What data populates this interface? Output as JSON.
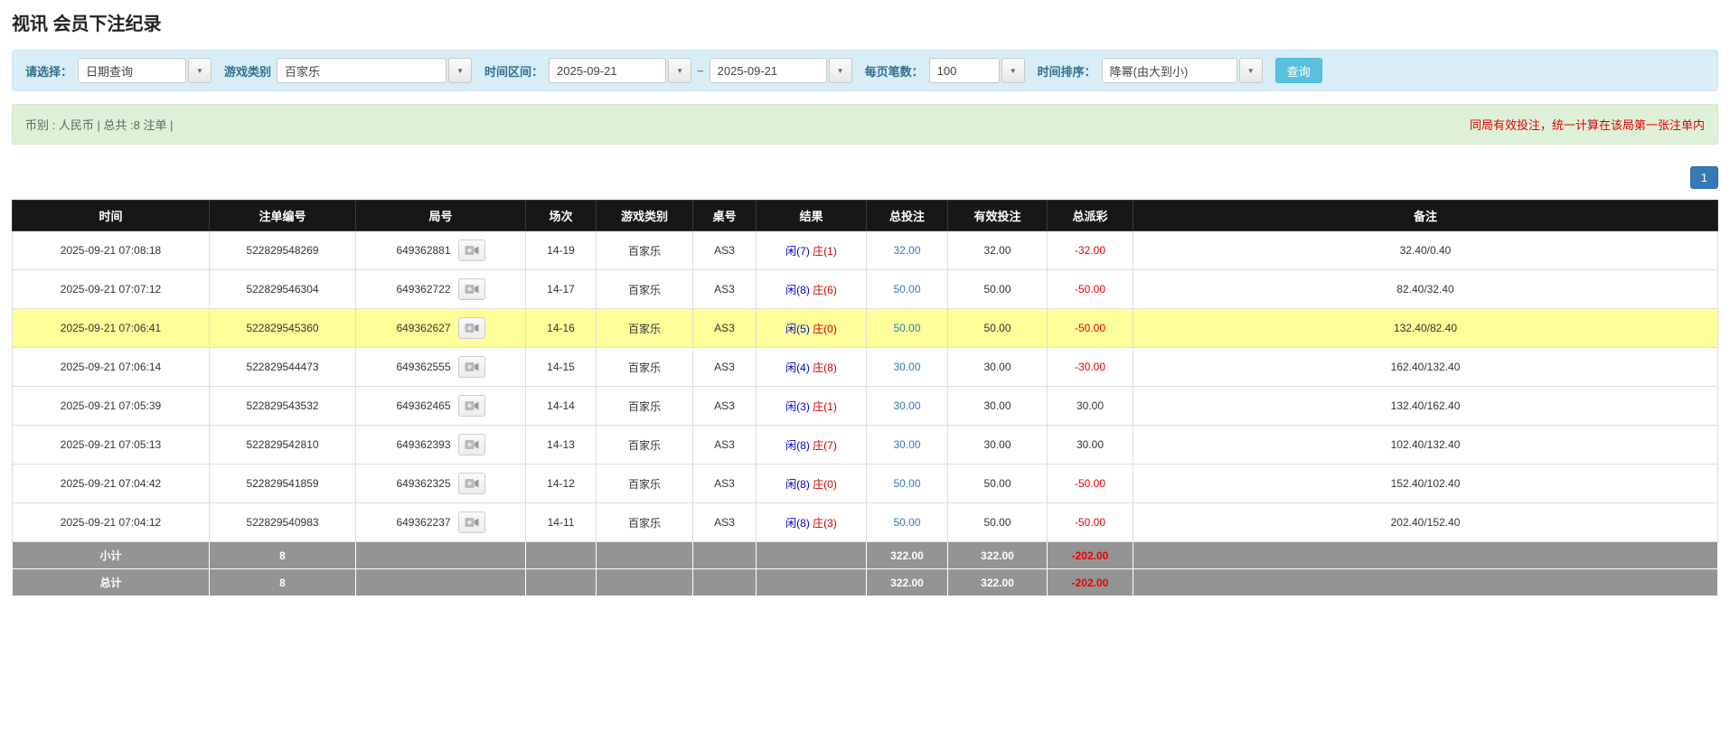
{
  "page": {
    "title": "视讯 会员下注纪录"
  },
  "filters": {
    "select_label": "请选择：",
    "select_value": "日期查询",
    "game_label": "游戏类别",
    "game_value": "百家乐",
    "period_label": "时间区间：",
    "date_from": "2025-09-21",
    "tilde": "~",
    "date_to": "2025-09-21",
    "per_page_label": "每页笔数：",
    "per_page_value": "100",
    "sort_label": "时间排序：",
    "sort_value": "降幂(由大到小)",
    "search_button": "查询",
    "caret_icon": "▼"
  },
  "info_bar": {
    "left": "币别 : 人民币 | 总共 :8 注单 |",
    "right": "同局有效投注，统一计算在该局第一张注单内"
  },
  "pagination": {
    "page": "1"
  },
  "colors": {
    "accent": "#5bc0de",
    "link": "#337ab7",
    "player_blue": "#0000cc",
    "banker_red": "#cc0000",
    "negative_red": "#e80000",
    "highlight_yellow": "#ffff99",
    "header_black": "#171717",
    "summary_gray": "#949494"
  },
  "table": {
    "headers": [
      "时间",
      "注单编号",
      "局号",
      "场次",
      "游戏类别",
      "桌号",
      "结果",
      "总投注",
      "有效投注",
      "总派彩",
      "备注"
    ],
    "rows": [
      {
        "time": "2025-09-21 07:08:18",
        "bet_no": "522829548269",
        "round_no": "649362881",
        "session": "14-19",
        "game": "百家乐",
        "table_no": "AS3",
        "result_player": "闲(7)",
        "result_banker": "庄(1)",
        "total_bet": "32.00",
        "valid_bet": "32.00",
        "payout": "-32.00",
        "note": "32.40/0.40",
        "highlight": false
      },
      {
        "time": "2025-09-21 07:07:12",
        "bet_no": "522829546304",
        "round_no": "649362722",
        "session": "14-17",
        "game": "百家乐",
        "table_no": "AS3",
        "result_player": "闲(8)",
        "result_banker": "庄(6)",
        "total_bet": "50.00",
        "valid_bet": "50.00",
        "payout": "-50.00",
        "note": "82.40/32.40",
        "highlight": false
      },
      {
        "time": "2025-09-21 07:06:41",
        "bet_no": "522829545360",
        "round_no": "649362627",
        "session": "14-16",
        "game": "百家乐",
        "table_no": "AS3",
        "result_player": "闲(5)",
        "result_banker": "庄(0)",
        "total_bet": "50.00",
        "valid_bet": "50.00",
        "payout": "-50.00",
        "note": "132.40/82.40",
        "highlight": true
      },
      {
        "time": "2025-09-21 07:06:14",
        "bet_no": "522829544473",
        "round_no": "649362555",
        "session": "14-15",
        "game": "百家乐",
        "table_no": "AS3",
        "result_player": "闲(4)",
        "result_banker": "庄(8)",
        "total_bet": "30.00",
        "valid_bet": "30.00",
        "payout": "-30.00",
        "note": "162.40/132.40",
        "highlight": false
      },
      {
        "time": "2025-09-21 07:05:39",
        "bet_no": "522829543532",
        "round_no": "649362465",
        "session": "14-14",
        "game": "百家乐",
        "table_no": "AS3",
        "result_player": "闲(3)",
        "result_banker": "庄(1)",
        "total_bet": "30.00",
        "valid_bet": "30.00",
        "payout": "30.00",
        "note": "132.40/162.40",
        "highlight": false
      },
      {
        "time": "2025-09-21 07:05:13",
        "bet_no": "522829542810",
        "round_no": "649362393",
        "session": "14-13",
        "game": "百家乐",
        "table_no": "AS3",
        "result_player": "闲(8)",
        "result_banker": "庄(7)",
        "total_bet": "30.00",
        "valid_bet": "30.00",
        "payout": "30.00",
        "note": "102.40/132.40",
        "highlight": false
      },
      {
        "time": "2025-09-21 07:04:42",
        "bet_no": "522829541859",
        "round_no": "649362325",
        "session": "14-12",
        "game": "百家乐",
        "table_no": "AS3",
        "result_player": "闲(8)",
        "result_banker": "庄(0)",
        "total_bet": "50.00",
        "valid_bet": "50.00",
        "payout": "-50.00",
        "note": "152.40/102.40",
        "highlight": false
      },
      {
        "time": "2025-09-21 07:04:12",
        "bet_no": "522829540983",
        "round_no": "649362237",
        "session": "14-11",
        "game": "百家乐",
        "table_no": "AS3",
        "result_player": "闲(8)",
        "result_banker": "庄(3)",
        "total_bet": "50.00",
        "valid_bet": "50.00",
        "payout": "-50.00",
        "note": "202.40/152.40",
        "highlight": false
      }
    ],
    "subtotal": {
      "label": "小计",
      "count": "8",
      "total_bet": "322.00",
      "valid_bet": "322.00",
      "payout": "-202.00"
    },
    "total": {
      "label": "总计",
      "count": "8",
      "total_bet": "322.00",
      "valid_bet": "322.00",
      "payout": "-202.00"
    }
  }
}
